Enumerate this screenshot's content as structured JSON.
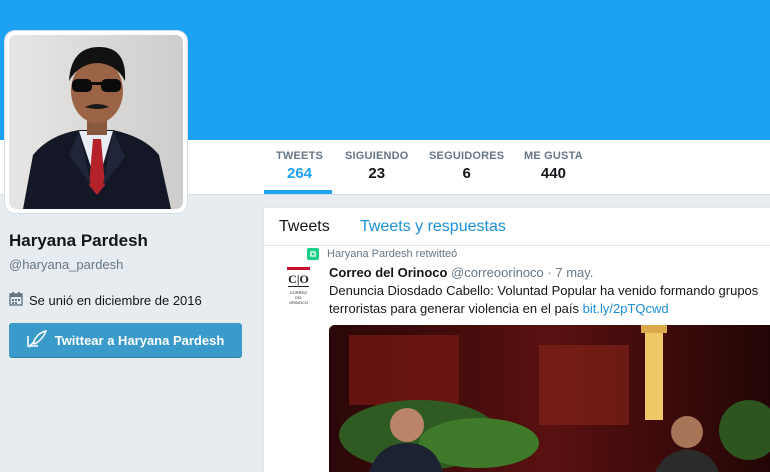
{
  "profile": {
    "name": "Haryana Pardesh",
    "handle": "@haryana_pardesh",
    "joined": "Se unió en diciembre de 2016",
    "tweet_button": "Twittear a Haryana Pardesh"
  },
  "stats": [
    {
      "label": "TWEETS",
      "value": "264"
    },
    {
      "label": "SIGUIENDO",
      "value": "23"
    },
    {
      "label": "SEGUIDORES",
      "value": "6"
    },
    {
      "label": "ME GUSTA",
      "value": "440"
    }
  ],
  "timeline": {
    "tabs": [
      "Tweets",
      "Tweets y respuestas"
    ],
    "tweet": {
      "retweet_label": "Haryana Pardesh retwitteó",
      "author_name": "Correo del Orinoco",
      "author_handle": "@correoorinoco",
      "separator": "·",
      "date": "7 may.",
      "text": "Denuncia Diosdado Cabello: Voluntad Popular ha venido formando grupos terroristas para generar violencia en el país",
      "link": "bit.ly/2pTQcwd",
      "logo_initials": "C|O",
      "logo_text": "CORREO DEL ORINOCO"
    }
  },
  "colors": {
    "banner": "#1da1f2",
    "accent": "#1da1f2",
    "button": "#3a9ac9",
    "retweet": "#19cf86"
  },
  "icons": {
    "calendar": "calendar-icon",
    "quill": "quill-icon",
    "retweet": "retweet-icon"
  }
}
